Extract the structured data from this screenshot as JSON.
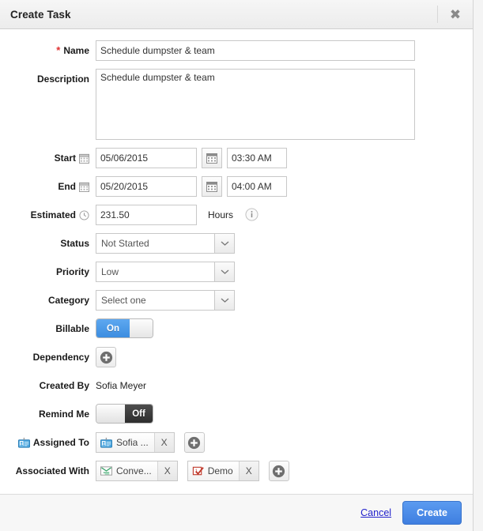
{
  "dialog": {
    "title": "Create Task",
    "close_icon": "close-icon"
  },
  "form": {
    "name": {
      "label": "Name",
      "required_marker": "*",
      "value": "Schedule dumpster & team"
    },
    "description": {
      "label": "Description",
      "value": "Schedule dumpster & team"
    },
    "start": {
      "label": "Start",
      "icon": "calendar-icon",
      "date": "05/06/2015",
      "time": "03:30 AM",
      "picker_icon": "calendar-picker-icon"
    },
    "end": {
      "label": "End",
      "icon": "calendar-icon",
      "date": "05/20/2015",
      "time": "04:00 AM",
      "picker_icon": "calendar-picker-icon"
    },
    "estimated": {
      "label": "Estimated",
      "icon": "clock-icon",
      "value": "231.50",
      "unit": "Hours",
      "info_icon": "info-icon"
    },
    "status": {
      "label": "Status",
      "value": "Not Started",
      "arrow_icon": "chevron-down-icon"
    },
    "priority": {
      "label": "Priority",
      "value": "Low",
      "arrow_icon": "chevron-down-icon"
    },
    "category": {
      "label": "Category",
      "value": "Select one",
      "arrow_icon": "chevron-down-icon"
    },
    "billable": {
      "label": "Billable",
      "state": "On"
    },
    "dependency": {
      "label": "Dependency",
      "add_icon": "plus-circle-icon"
    },
    "created_by": {
      "label": "Created By",
      "value": "Sofia Meyer"
    },
    "remind_me": {
      "label": "Remind Me",
      "state": "Off"
    },
    "assigned_to": {
      "label": "Assigned To",
      "label_icon": "contact-card-icon",
      "add_icon": "plus-circle-icon",
      "chips": [
        {
          "text": "Sofia ...",
          "icon": "contact-card-icon",
          "remove": "X"
        }
      ]
    },
    "associated_with": {
      "label": "Associated With",
      "add_icon": "plus-circle-icon",
      "chips": [
        {
          "text": "Conve...",
          "icon": "conversation-icon",
          "remove": "X"
        },
        {
          "text": "Demo",
          "icon": "task-check-icon",
          "remove": "X"
        }
      ]
    }
  },
  "footer": {
    "cancel_label": "Cancel",
    "create_label": "Create"
  },
  "colors": {
    "accent_blue": "#4a8ae4",
    "required_red": "#e03131",
    "link_blue": "#2222cc",
    "toggle_off_dark": "#2e2e2e"
  }
}
